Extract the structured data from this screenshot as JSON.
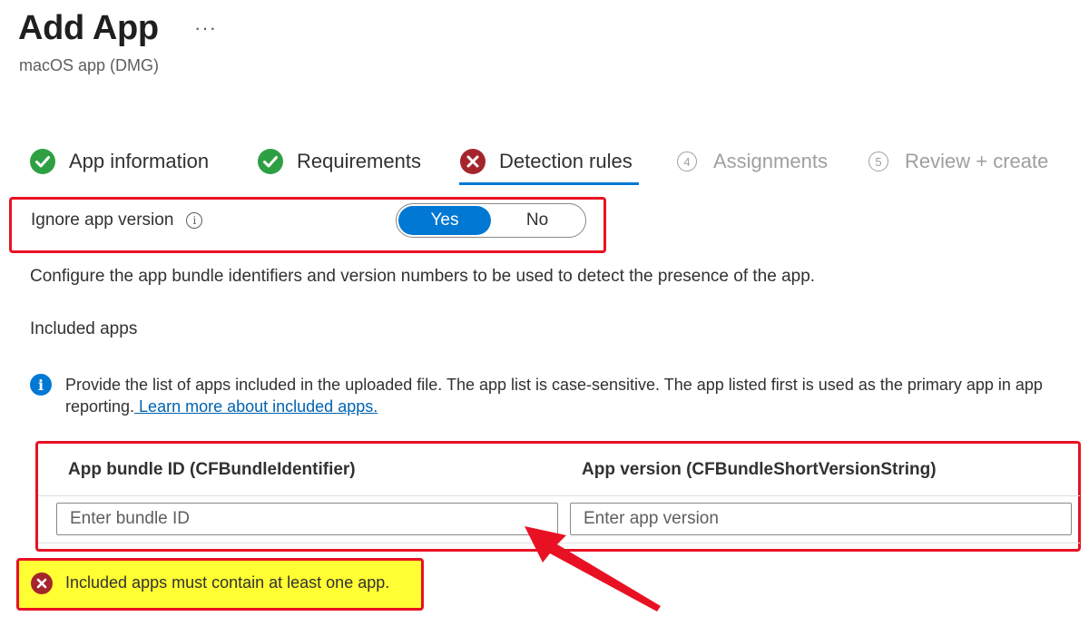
{
  "header": {
    "title": "Add App",
    "more_label": "···",
    "subtitle": "macOS app (DMG)"
  },
  "steps": [
    {
      "label": "App information",
      "status": "complete"
    },
    {
      "label": "Requirements",
      "status": "complete"
    },
    {
      "label": "Detection rules",
      "status": "error",
      "active": true
    },
    {
      "label": "Assignments",
      "number": "4",
      "status": "disabled"
    },
    {
      "label": "Review + create",
      "number": "5",
      "status": "disabled"
    }
  ],
  "ignore_version": {
    "label": "Ignore app version",
    "info_glyph": "i",
    "options": [
      "Yes",
      "No"
    ],
    "selected": "Yes"
  },
  "description": "Configure the app bundle identifiers and version numbers to be used to detect the presence of the app.",
  "included_apps": {
    "heading": "Included apps",
    "info": "Provide the list of apps included in the uploaded file. The app list is case-sensitive. The app listed first is used as the primary app in app reporting.",
    "link": " Learn more about included apps.",
    "columns": [
      "App bundle ID (CFBundleIdentifier)",
      "App version (CFBundleShortVersionString)"
    ],
    "bundle_placeholder": "Enter bundle ID",
    "version_placeholder": "Enter app version"
  },
  "error": {
    "message": "Included apps must contain at least one app."
  },
  "colors": {
    "success": "#2ea043",
    "error": "#a4262c",
    "accent": "#0078d4",
    "annotation": "#e81123",
    "highlight": "#ffff33"
  }
}
